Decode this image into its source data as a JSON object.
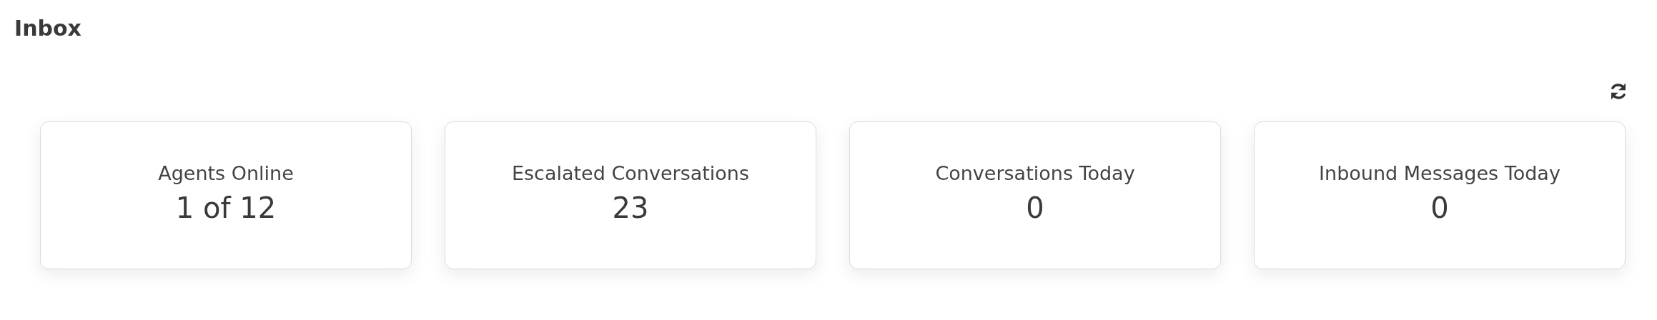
{
  "title": "Inbox",
  "cards": [
    {
      "label": "Agents Online",
      "value": "1 of 12"
    },
    {
      "label": "Escalated Conversations",
      "value": "23"
    },
    {
      "label": "Conversations Today",
      "value": "0"
    },
    {
      "label": "Inbound Messages Today",
      "value": "0"
    }
  ]
}
